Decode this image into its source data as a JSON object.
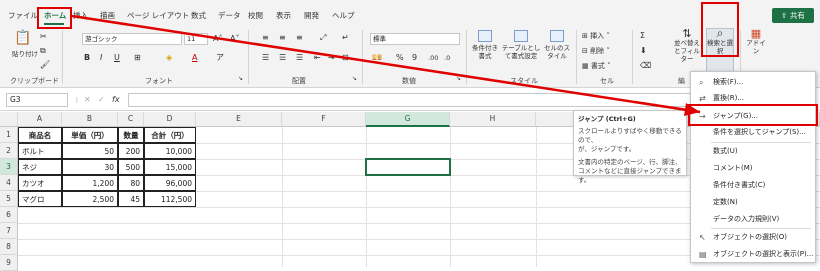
{
  "tabs": [
    "ファイル",
    "ホーム",
    "挿入",
    "描画",
    "ページ レイアウト",
    "数式",
    "データ",
    "校閲",
    "表示",
    "開発",
    "ヘルプ"
  ],
  "share_label": "共有",
  "ribbon": {
    "paste_label": "貼り付け",
    "clipboard_label": "クリップボード",
    "font_name": "游ゴシック",
    "font_size": "11",
    "font_label": "フォント",
    "align_label": "配置",
    "number_format": "標準",
    "number_label": "数値",
    "style_btn1": "条件付き書式",
    "style_btn2": "テーブルとして書式設定",
    "style_btn3": "セルのスタイル",
    "style_label": "スタイル",
    "cell_insert": "挿入",
    "cell_delete": "削除",
    "cell_format": "書式",
    "cell_label": "セル",
    "sort_filter": "並べ替えとフィルター",
    "find_select": "検索と選択",
    "edit_label": "編",
    "addin": "アドイン"
  },
  "formula_bar": {
    "name_box": "G3",
    "fx": "fx"
  },
  "columns": [
    "A",
    "B",
    "C",
    "D",
    "E",
    "F",
    "G",
    "H"
  ],
  "rows": [
    "1",
    "2",
    "3",
    "4",
    "5",
    "6",
    "7",
    "8",
    "9"
  ],
  "table": {
    "headers": [
      "商品名",
      "単価（円）",
      "数量",
      "合計（円）"
    ],
    "rows": [
      [
        "ボルト",
        "50",
        "200",
        "10,000"
      ],
      [
        "ネジ",
        "30",
        "500",
        "15,000"
      ],
      [
        "カツオ",
        "1,200",
        "80",
        "96,000"
      ],
      [
        "マグロ",
        "2,500",
        "45",
        "112,500"
      ]
    ]
  },
  "tooltip": {
    "title": "ジャンプ (Ctrl+G)",
    "line1": "スクロールよりすばやく移動できるので、",
    "line2": "が、ジャンプです。",
    "line3": "文書内の特定のページ、行、脚注、",
    "line4": "コメントなどに直接ジャンプできます。"
  },
  "menu": [
    "検索(F)...",
    "置換(R)...",
    "ジャンプ(G)...",
    "条件を選択してジャンプ(S)...",
    "数式(U)",
    "コメント(M)",
    "条件付き書式(C)",
    "定数(N)",
    "データの入力規則(V)",
    "オブジェクトの選択(O)",
    "オブジェクトの選択と表示(P)..."
  ],
  "colors": {
    "accent": "#1e7145",
    "highlight": "#e00000"
  }
}
